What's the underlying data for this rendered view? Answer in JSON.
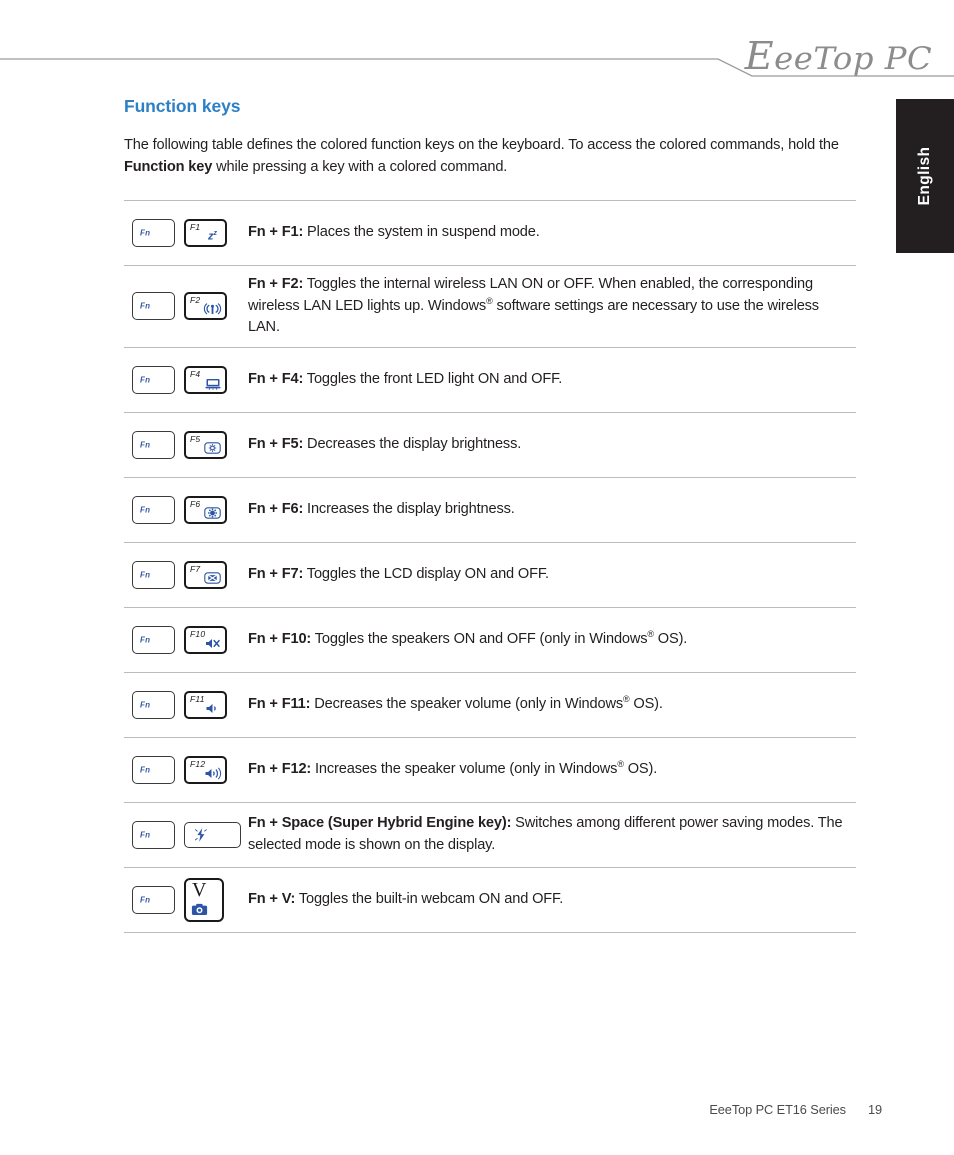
{
  "header": {
    "logo_text": "EeeTop PC",
    "logo_initial": "E",
    "logo_rest": "eeTop PC"
  },
  "language_tab": {
    "label": "English"
  },
  "page": {
    "title": "Function keys",
    "intro_part1": "The following table defines the colored function keys on the keyboard. To access the colored commands, hold the ",
    "intro_bold": "Function key",
    "intro_part2": " while pressing a key with a colored command."
  },
  "keycaps": {
    "fn_label": "Fn",
    "v_label": "V"
  },
  "table": {
    "rows": [
      {
        "fn_key": "Fn",
        "key_label": "F1",
        "key_type": "function",
        "icon": "sleep-zz-icon",
        "combo": "Fn + F1:",
        "description": " Places the system in suspend mode."
      },
      {
        "fn_key": "Fn",
        "key_label": "F2",
        "key_type": "function",
        "icon": "wireless-lan-icon",
        "combo": "Fn + F2:",
        "description": " Toggles the internal wireless LAN ON or OFF. When enabled, the corresponding wireless LAN LED lights up. Windows® software settings are necessary to use the wireless LAN."
      },
      {
        "fn_key": "Fn",
        "key_label": "F4",
        "key_type": "function",
        "icon": "front-led-light-icon",
        "combo": "Fn + F4:",
        "description": " Toggles the front LED light ON and OFF."
      },
      {
        "fn_key": "Fn",
        "key_label": "F5",
        "key_type": "function",
        "icon": "brightness-down-icon",
        "combo": "Fn + F5:",
        "description": " Decreases the display brightness."
      },
      {
        "fn_key": "Fn",
        "key_label": "F6",
        "key_type": "function",
        "icon": "brightness-up-icon",
        "combo": "Fn + F6:",
        "description": " Increases the display brightness."
      },
      {
        "fn_key": "Fn",
        "key_label": "F7",
        "key_type": "function",
        "icon": "lcd-display-toggle-icon",
        "combo": "Fn + F7:",
        "description": " Toggles the LCD display ON and OFF."
      },
      {
        "fn_key": "Fn",
        "key_label": "F10",
        "key_type": "function",
        "icon": "speaker-mute-icon",
        "combo": "Fn + F10:",
        "description": " Toggles the speakers ON and OFF (only in Windows® OS)."
      },
      {
        "fn_key": "Fn",
        "key_label": "F11",
        "key_type": "function",
        "icon": "volume-down-icon",
        "combo": "Fn + F11:",
        "description": " Decreases the speaker volume (only in Windows® OS)."
      },
      {
        "fn_key": "Fn",
        "key_label": "F12",
        "key_type": "function",
        "icon": "volume-up-icon",
        "combo": "Fn + F12:",
        "description": " Increases the speaker volume (only in Windows® OS)."
      },
      {
        "fn_key": "Fn",
        "key_label": "",
        "key_type": "space",
        "icon": "super-hybrid-engine-icon",
        "combo": "Fn + Space (Super Hybrid Engine key):",
        "description": " Switches among different power saving modes. The selected mode is shown on the display."
      },
      {
        "fn_key": "Fn",
        "key_label": "V",
        "key_type": "letter",
        "icon": "webcam-camera-icon",
        "combo": "Fn + V:",
        "description": " Toggles the built-in webcam ON and OFF."
      }
    ]
  },
  "footer": {
    "book_title": "EeeTop PC ET16 Series",
    "page_number": "19"
  },
  "colors": {
    "heading_blue": "#2e80c4",
    "icon_blue": "#2c55a7",
    "tab_black": "#231f20",
    "rule_gray": "#bcbcbc"
  }
}
